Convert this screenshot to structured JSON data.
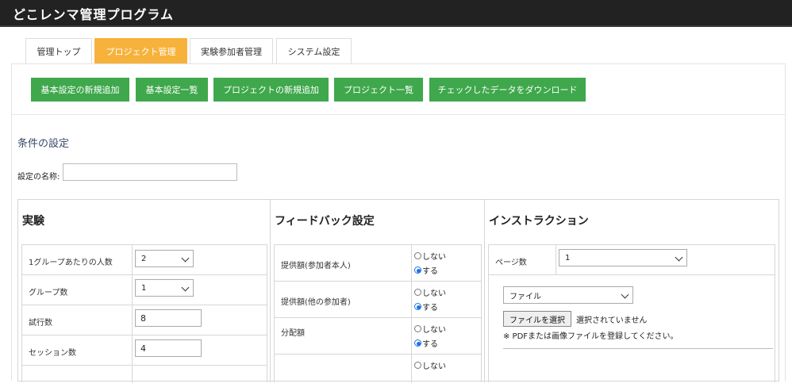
{
  "app": {
    "title": "どこレンマ管理プログラム"
  },
  "tabs": [
    {
      "label": "管理トップ",
      "active": false
    },
    {
      "label": "プロジェクト管理",
      "active": true
    },
    {
      "label": "実験参加者管理",
      "active": false
    },
    {
      "label": "システム設定",
      "active": false
    }
  ],
  "actions": [
    "基本設定の新規追加",
    "基本設定一覧",
    "プロジェクトの新規追加",
    "プロジェクト一覧",
    "チェックしたデータをダウンロード"
  ],
  "conditions": {
    "title": "条件の設定",
    "name_label": "設定の名称:",
    "name_value": ""
  },
  "experiment": {
    "heading": "実験",
    "rows": [
      {
        "label": "1グループあたりの人数",
        "value": "2",
        "control": "select"
      },
      {
        "label": "グループ数",
        "value": "1",
        "control": "select"
      },
      {
        "label": "試行数",
        "value": "8",
        "control": "text"
      },
      {
        "label": "セッション数",
        "value": "4",
        "control": "text"
      }
    ]
  },
  "feedback": {
    "heading": "フィードバック設定",
    "option_no": "しない",
    "option_yes": "する",
    "rows": [
      {
        "label": "提供額(参加者本人)",
        "selected": "yes"
      },
      {
        "label": "提供額(他の参加者)",
        "selected": "yes"
      },
      {
        "label": "分配額",
        "selected": "yes"
      },
      {
        "label": "",
        "selected": ""
      }
    ]
  },
  "instruction": {
    "heading": "インストラクション",
    "pages_label": "ページ数",
    "pages_value": "1",
    "file_type_value": "ファイル",
    "file_button": "ファイルを選択",
    "file_status": "選択されていません",
    "file_note": "※ PDFまたは画像ファイルを登録してください。"
  },
  "colors": {
    "accent": "#f7b23b",
    "button": "#3fa84c",
    "topbar": "#222222",
    "radio": "#1a73e8"
  }
}
